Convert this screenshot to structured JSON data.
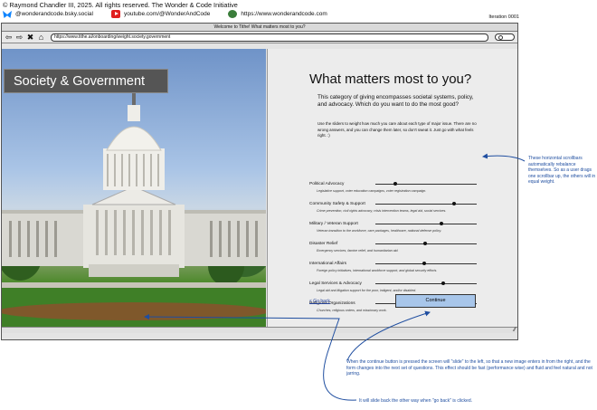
{
  "header": {
    "copyright": "© Raymond Chandler III, 2025. All rights reserved. The Wonder & Code Initiative",
    "bluesky": "@wonderandcode.bsky.social",
    "youtube": "youtube.com/@WonderAndCode",
    "website": "https://www.wonderandcode.com",
    "iteration": "Iteration 0001"
  },
  "browser": {
    "title": "Welcome to Tithe! What matters most to you?",
    "url": "https://www.tithe.ai/onboarding/weight.society.government",
    "icons": [
      "back-arrow-icon",
      "forward-arrow-icon",
      "close-icon",
      "home-icon",
      "search-icon"
    ]
  },
  "left": {
    "category_label": "Society & Government"
  },
  "form": {
    "title": "What matters most to you?",
    "intro": "This category of giving encompasses societal systems, policy, and advocacy. Which do you want to do the most good?",
    "instructions": "Use the sliders to weight how much you care about each type of major issue. There are no wrong answers, and you can change them later, so don't sweat it. Just go with what feels right. :)",
    "categories": [
      {
        "name": "Political Advocacy",
        "desc": "Legislative support, voter education campaigns, voter registration campaign.",
        "level": 0.2
      },
      {
        "name": "Community Safety & Support",
        "desc": "Crime prevention, civil rights advocacy, crisis intervention teams, legal aid, social services.",
        "level": 0.78
      },
      {
        "name": "Military / Veteran Support",
        "desc": "Veteran transition to the workforce, care packages, healthcare, national defense policy.",
        "level": 0.65
      },
      {
        "name": "Disaster Relief",
        "desc": "Emergency services, famine relief, and humanitarian aid.",
        "level": 0.49
      },
      {
        "name": "International Affairs",
        "desc": "Foreign policy initiatives, international workforce support, and global security efforts.",
        "level": 0.48
      },
      {
        "name": "Legal Services & Advocacy",
        "desc": "Legal aid and litigation support for the poor, indigent, and/or disabled.",
        "level": 0.67
      },
      {
        "name": "Religious Organizations",
        "desc": "Churches, religious orders, and missionary work.",
        "level": 0.28
      }
    ],
    "go_back": "< Go back",
    "continue": "Continue"
  },
  "annotations": {
    "sliders_note": "These horizontal scrollbars automatically rebalance themselves. So as a user drags one scrollbar up, the others will in equal weight.",
    "continue_note": "When the continue button is pressed the screen will \"slide\" to the left, so that a new image enters in from the right, and the form changes into the next set of questions. This effect should be fast (performance wise) and fluid and feel natural and not jarring.",
    "go_back_note": "It will slide back the other way when \"go back\" is clicked."
  },
  "colors": {
    "accent_button": "#a8c6ea",
    "annotation": "#1f4ea0",
    "category_label_bg": "#555555"
  }
}
